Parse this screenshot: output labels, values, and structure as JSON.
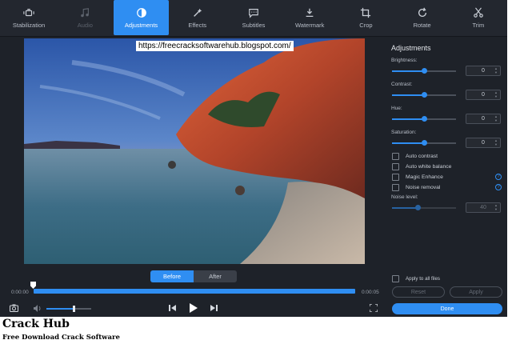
{
  "toolbar": {
    "tabs": [
      {
        "label": "Stabilization",
        "icon": "stabilization-icon"
      },
      {
        "label": "Audio",
        "icon": "music-note-icon"
      },
      {
        "label": "Adjustments",
        "icon": "adjustments-icon"
      },
      {
        "label": "Effects",
        "icon": "magic-wand-icon"
      },
      {
        "label": "Subtitles",
        "icon": "speech-bubble-icon"
      },
      {
        "label": "Watermark",
        "icon": "watermark-icon"
      },
      {
        "label": "Crop",
        "icon": "crop-icon"
      },
      {
        "label": "Rotate",
        "icon": "rotate-icon"
      },
      {
        "label": "Trim",
        "icon": "scissors-icon"
      }
    ],
    "active_tab": "Adjustments",
    "disabled_tab": "Audio"
  },
  "overlay_url": "https://freecracksoftwarehub.blogspot.com/",
  "compare": {
    "before": "Before",
    "after": "After",
    "selected": "Before"
  },
  "timeline": {
    "start": "0:00:00",
    "end": "0:00:05"
  },
  "panel": {
    "title": "Adjustments",
    "brightness": {
      "label": "Brightness:",
      "value": "0",
      "level": 0.5
    },
    "contrast": {
      "label": "Contrast:",
      "value": "0",
      "level": 0.5
    },
    "hue": {
      "label": "Hue:",
      "value": "0",
      "level": 0.5
    },
    "saturation": {
      "label": "Saturation:",
      "value": "0",
      "level": 0.5
    },
    "checks": {
      "auto_contrast": "Auto contrast",
      "auto_white_balance": "Auto white balance",
      "magic_enhance": "Magic Enhance",
      "noise_removal": "Noise removal"
    },
    "noise_level": {
      "label": "Noise level:",
      "value": "40",
      "level": 0.4
    },
    "apply_all": "Apply to all files",
    "reset": "Reset",
    "apply": "Apply",
    "done": "Done"
  },
  "volume_level": 0.6,
  "branding": {
    "title": "Crack Hub",
    "subtitle": "Free Download Crack Software"
  },
  "colors": {
    "accent": "#2f8ef2",
    "background": "#1e2229"
  }
}
